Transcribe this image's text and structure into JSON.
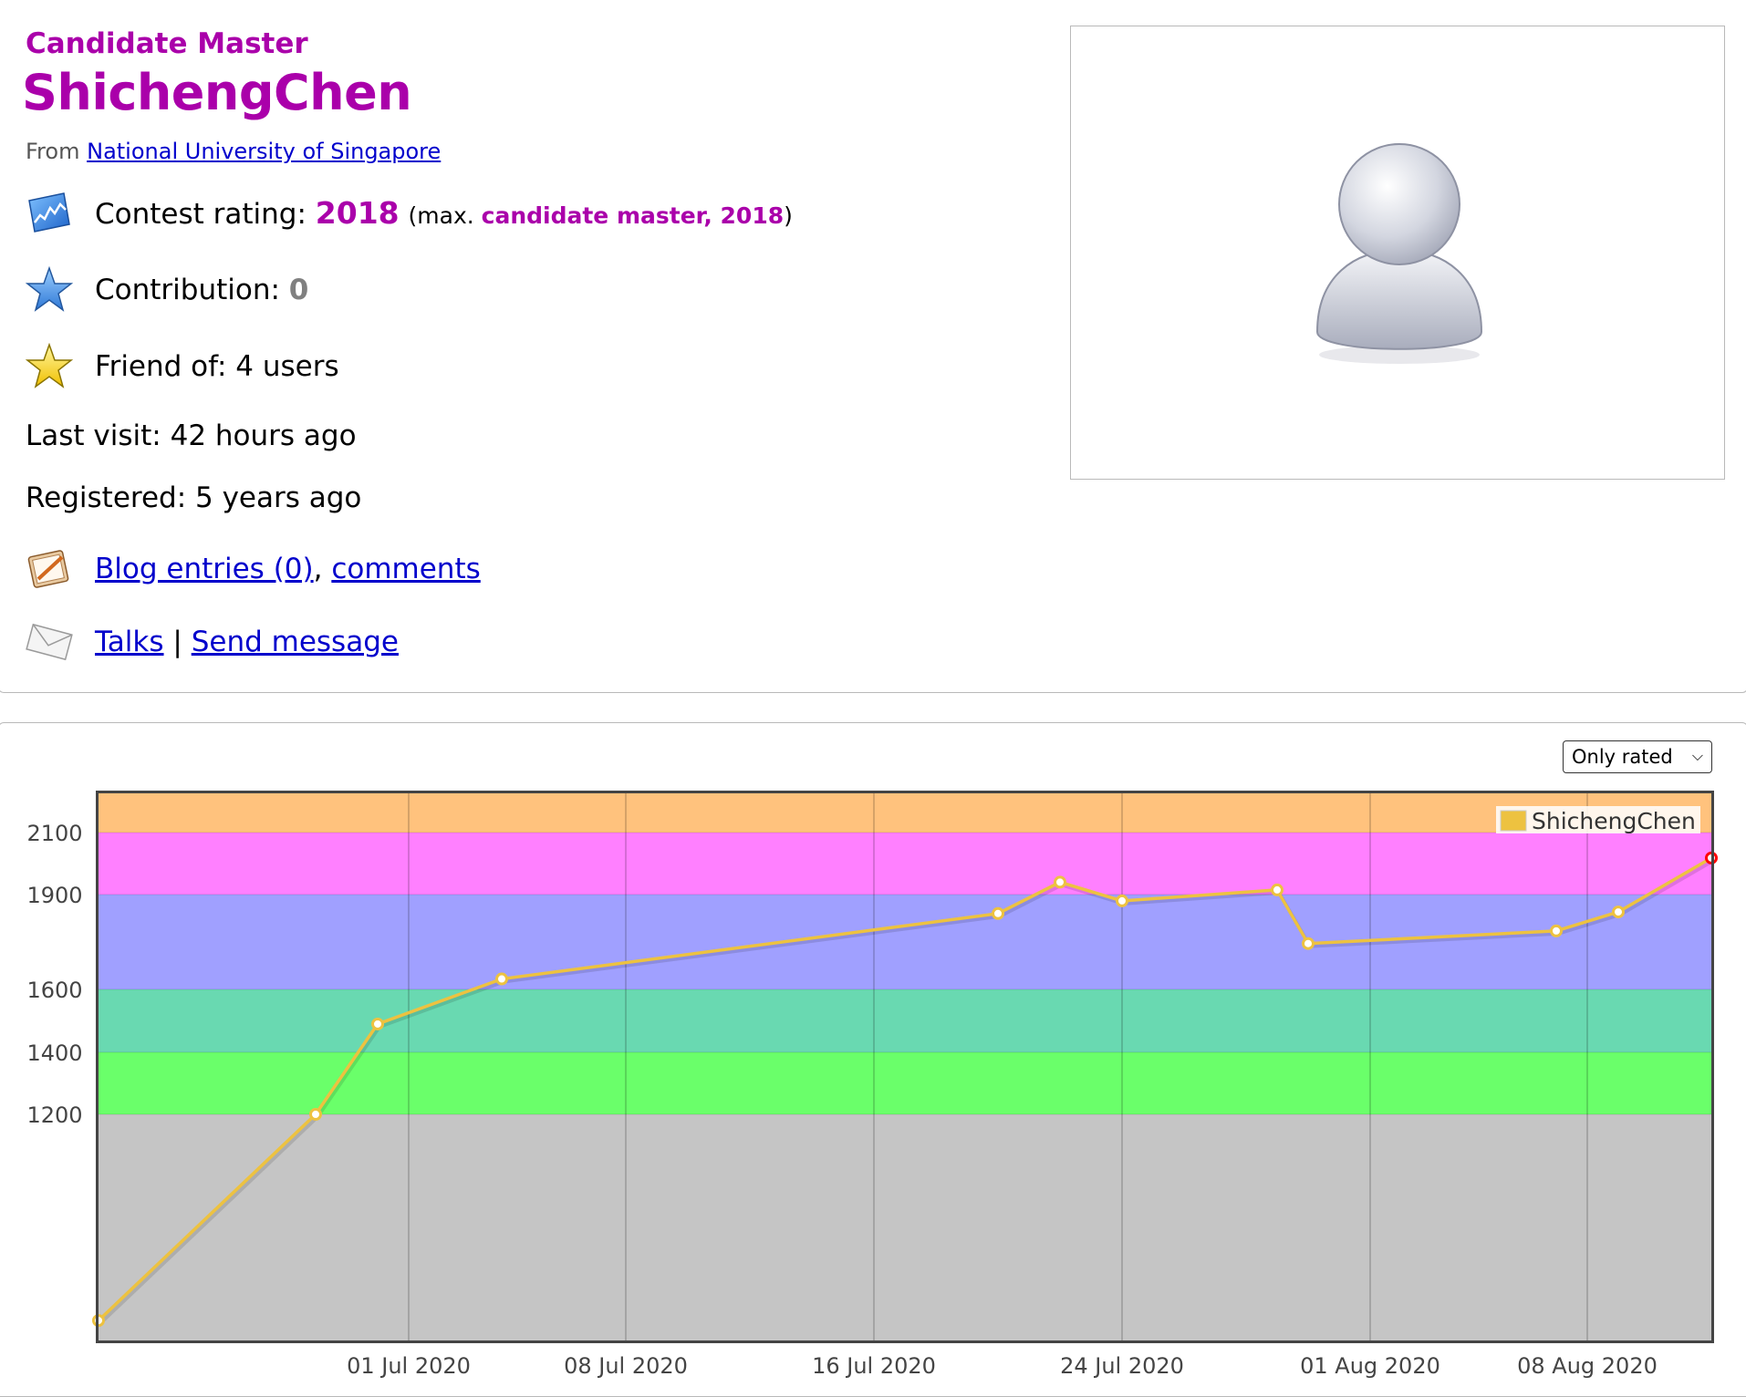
{
  "profile": {
    "rank": "Candidate Master",
    "handle": "ShichengChen",
    "from_label": "From",
    "organization": "National University of Singapore",
    "rating_label": "Contest rating:",
    "rating_value": "2018",
    "max_open": "(max.",
    "max_value": "candidate master, 2018",
    "max_close": ")",
    "contribution_label": "Contribution:",
    "contribution_value": "0",
    "friend_label": "Friend of:",
    "friend_value": "4 users",
    "last_visit": "Last visit: 42 hours ago",
    "registered": "Registered: 5 years ago",
    "blog_entries": "Blog entries (0)",
    "comma": ",",
    "comments": "comments",
    "talks": "Talks",
    "separator": "|",
    "send_message": "Send message",
    "colors": {
      "rank": "#aa00aa",
      "link": "#0000cc",
      "contribution": "#808080"
    }
  },
  "icons": [
    "rating-graph-icon",
    "contribution-star-icon",
    "friend-star-icon",
    "blog-notebook-icon",
    "envelope-icon",
    "user-avatar-icon"
  ],
  "graph": {
    "select_label": "Only rated",
    "legend_name": "ShichengChen"
  },
  "chart_data": {
    "type": "line",
    "series": [
      {
        "name": "ShichengChen",
        "color": "#edc240",
        "x": [
          "2020-06-21",
          "2020-06-28",
          "2020-06-30",
          "2020-07-04",
          "2020-07-20",
          "2020-07-22",
          "2020-07-24",
          "2020-07-29",
          "2020-07-30",
          "2020-08-07",
          "2020-08-09",
          "2020-08-12"
        ],
        "values": [
          580,
          1200,
          1490,
          1633,
          1840,
          1940,
          1880,
          1915,
          1745,
          1785,
          1845,
          2018
        ]
      }
    ],
    "x_ticks": [
      "01 Jul 2020",
      "08 Jul 2020",
      "16 Jul 2020",
      "24 Jul 2020",
      "01 Aug 2020",
      "08 Aug 2020"
    ],
    "x_tick_dates": [
      "2020-07-01",
      "2020-07-08",
      "2020-07-16",
      "2020-07-24",
      "2020-08-01",
      "2020-08-08"
    ],
    "y_ticks": [
      "1200",
      "1400",
      "1600",
      "1900",
      "2100"
    ],
    "y_tick_values": [
      1200,
      1400,
      1600,
      1900,
      2100
    ],
    "xlim": [
      "2020-06-21",
      "2020-08-12"
    ],
    "ylim": [
      520,
      2220
    ],
    "grid": true,
    "legend": "top-right",
    "bands": [
      {
        "from": 520,
        "to": 1200,
        "color": "#c5c5c5"
      },
      {
        "from": 1200,
        "to": 1400,
        "color": "#6aff6a"
      },
      {
        "from": 1400,
        "to": 1600,
        "color": "#69d9b1"
      },
      {
        "from": 1600,
        "to": 1900,
        "color": "#a0a0ff"
      },
      {
        "from": 1900,
        "to": 2100,
        "color": "#ff80ff"
      },
      {
        "from": 2100,
        "to": 2220,
        "color": "#ffc27d"
      }
    ],
    "last_point_color": "#ff0000"
  }
}
